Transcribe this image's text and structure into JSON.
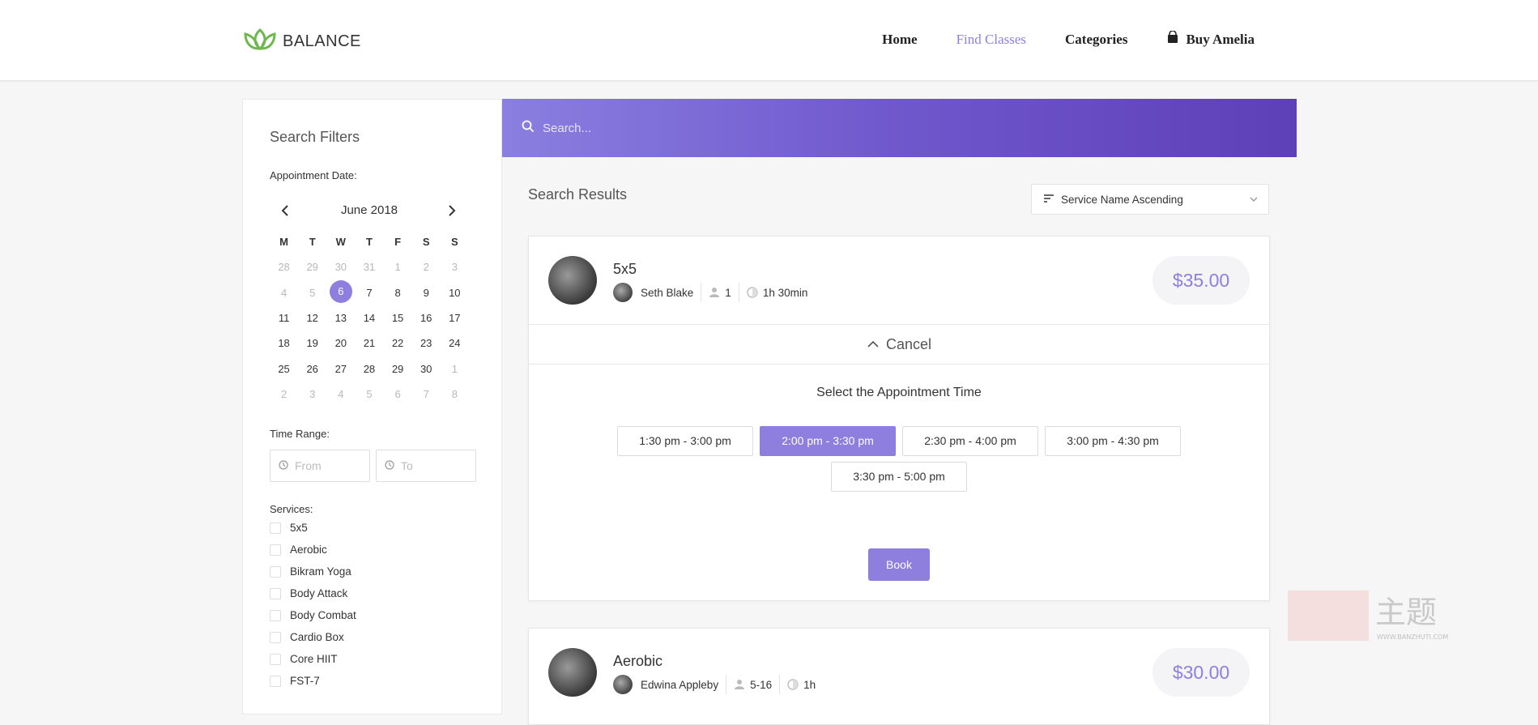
{
  "header": {
    "brand": "BALANCE",
    "nav": [
      "Home",
      "Find Classes",
      "Categories",
      "Buy Amelia"
    ],
    "active_nav": "Find Classes",
    "accent_color": "#8e7fdf"
  },
  "sidebar": {
    "title": "Search Filters",
    "date_label": "Appointment Date:",
    "calendar": {
      "month": "June 2018",
      "weekdays": [
        "M",
        "T",
        "W",
        "T",
        "F",
        "S",
        "S"
      ],
      "weeks": [
        [
          "28",
          "29",
          "30",
          "31",
          "1",
          "2",
          "3"
        ],
        [
          "4",
          "5",
          "6",
          "7",
          "8",
          "9",
          "10"
        ],
        [
          "11",
          "12",
          "13",
          "14",
          "15",
          "16",
          "17"
        ],
        [
          "18",
          "19",
          "20",
          "21",
          "22",
          "23",
          "24"
        ],
        [
          "25",
          "26",
          "27",
          "28",
          "29",
          "30",
          "1"
        ],
        [
          "2",
          "3",
          "4",
          "5",
          "6",
          "7",
          "8"
        ]
      ],
      "selected": "6"
    },
    "time_range_label": "Time Range:",
    "time_from_placeholder": "From",
    "time_to_placeholder": "To",
    "services_label": "Services:",
    "services": [
      "5x5",
      "Aerobic",
      "Bikram Yoga",
      "Body Attack",
      "Body Combat",
      "Cardio Box",
      "Core HIIT",
      "FST-7"
    ]
  },
  "search": {
    "placeholder": "Search..."
  },
  "results": {
    "title": "Search Results",
    "sort_label": "Service Name Ascending",
    "cards": [
      {
        "name": "5x5",
        "employee": "Seth Blake",
        "capacity": "1",
        "duration": "1h 30min",
        "price": "$35.00",
        "cancel_label": "Cancel",
        "appointment_title": "Select the Appointment Time",
        "slots": [
          "1:30 pm - 3:00 pm",
          "2:00 pm - 3:30 pm",
          "2:30 pm - 4:00 pm",
          "3:00 pm - 4:30 pm",
          "3:30 pm - 5:00 pm"
        ],
        "selected_slot": "2:00 pm - 3:30 pm",
        "book_label": "Book"
      },
      {
        "name": "Aerobic",
        "employee": "Edwina Appleby",
        "capacity": "5-16",
        "duration": "1h",
        "price": "$30.00"
      }
    ]
  },
  "watermark": {
    "text": "主题",
    "url": "WWW.BANZHUTI.COM"
  }
}
